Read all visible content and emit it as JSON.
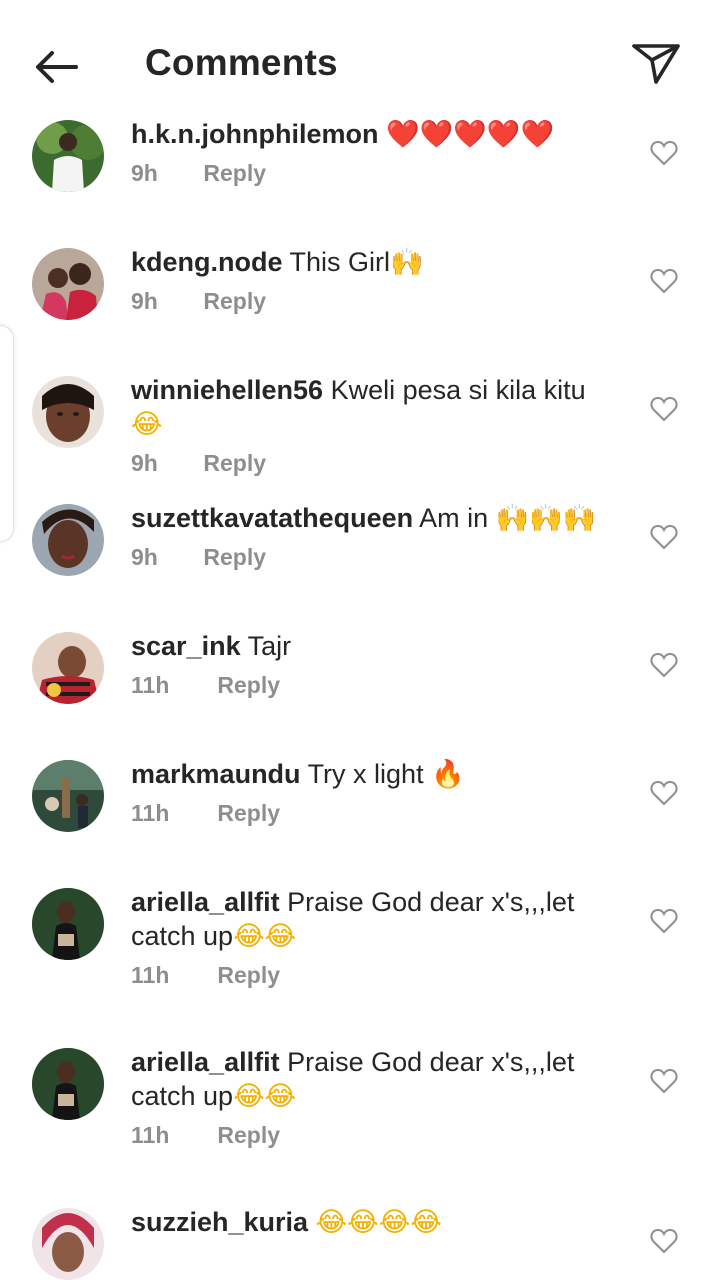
{
  "header": {
    "title": "Comments"
  },
  "comments": [
    {
      "username": "h.k.n.johnphilemon",
      "text": "",
      "emoji": "❤️❤️❤️❤️❤️",
      "time": "9h",
      "reply_label": "Reply",
      "emoji_color": "#e0162b"
    },
    {
      "username": "kdeng.node",
      "text": "This Girl",
      "emoji": "🙌",
      "time": "9h",
      "reply_label": "Reply",
      "emoji_color": "#f3b000"
    },
    {
      "username": "winniehellen56",
      "text": "Kweli pesa si kila kitu",
      "emoji": "😂",
      "time": "9h",
      "reply_label": "Reply",
      "emoji_color": "#f3b000"
    },
    {
      "username": "suzettkavatathequeen",
      "text": "Am in ",
      "emoji": "🙌🙌🙌",
      "time": "9h",
      "reply_label": "Reply",
      "emoji_color": "#f3b000"
    },
    {
      "username": "scar_ink",
      "text": "Tajr",
      "emoji": "",
      "time": "11h",
      "reply_label": "Reply",
      "emoji_color": "#f3b000"
    },
    {
      "username": "markmaundu",
      "text": "Try x light ",
      "emoji": "🔥",
      "time": "11h",
      "reply_label": "Reply",
      "emoji_color": "#f28b00"
    },
    {
      "username": "ariella_allfit",
      "text": "Praise God dear x's,,,let catch up",
      "emoji": "😂😂",
      "time": "11h",
      "reply_label": "Reply",
      "emoji_color": "#f3b000"
    },
    {
      "username": "ariella_allfit",
      "text": "Praise God dear x's,,,let catch up",
      "emoji": "😂😂",
      "time": "11h",
      "reply_label": "Reply",
      "emoji_color": "#f3b000"
    },
    {
      "username": "suzzieh_kuria",
      "text": "",
      "emoji": "😂😂😂😂",
      "time": "",
      "reply_label": "",
      "emoji_color": "#f3b000"
    }
  ],
  "colors": {
    "text_primary": "#262626",
    "text_secondary": "#8e8e8e",
    "background": "#ffffff"
  },
  "icons": {
    "back": "arrow-left-icon",
    "send": "paper-plane-icon",
    "like": "heart-outline-icon"
  }
}
